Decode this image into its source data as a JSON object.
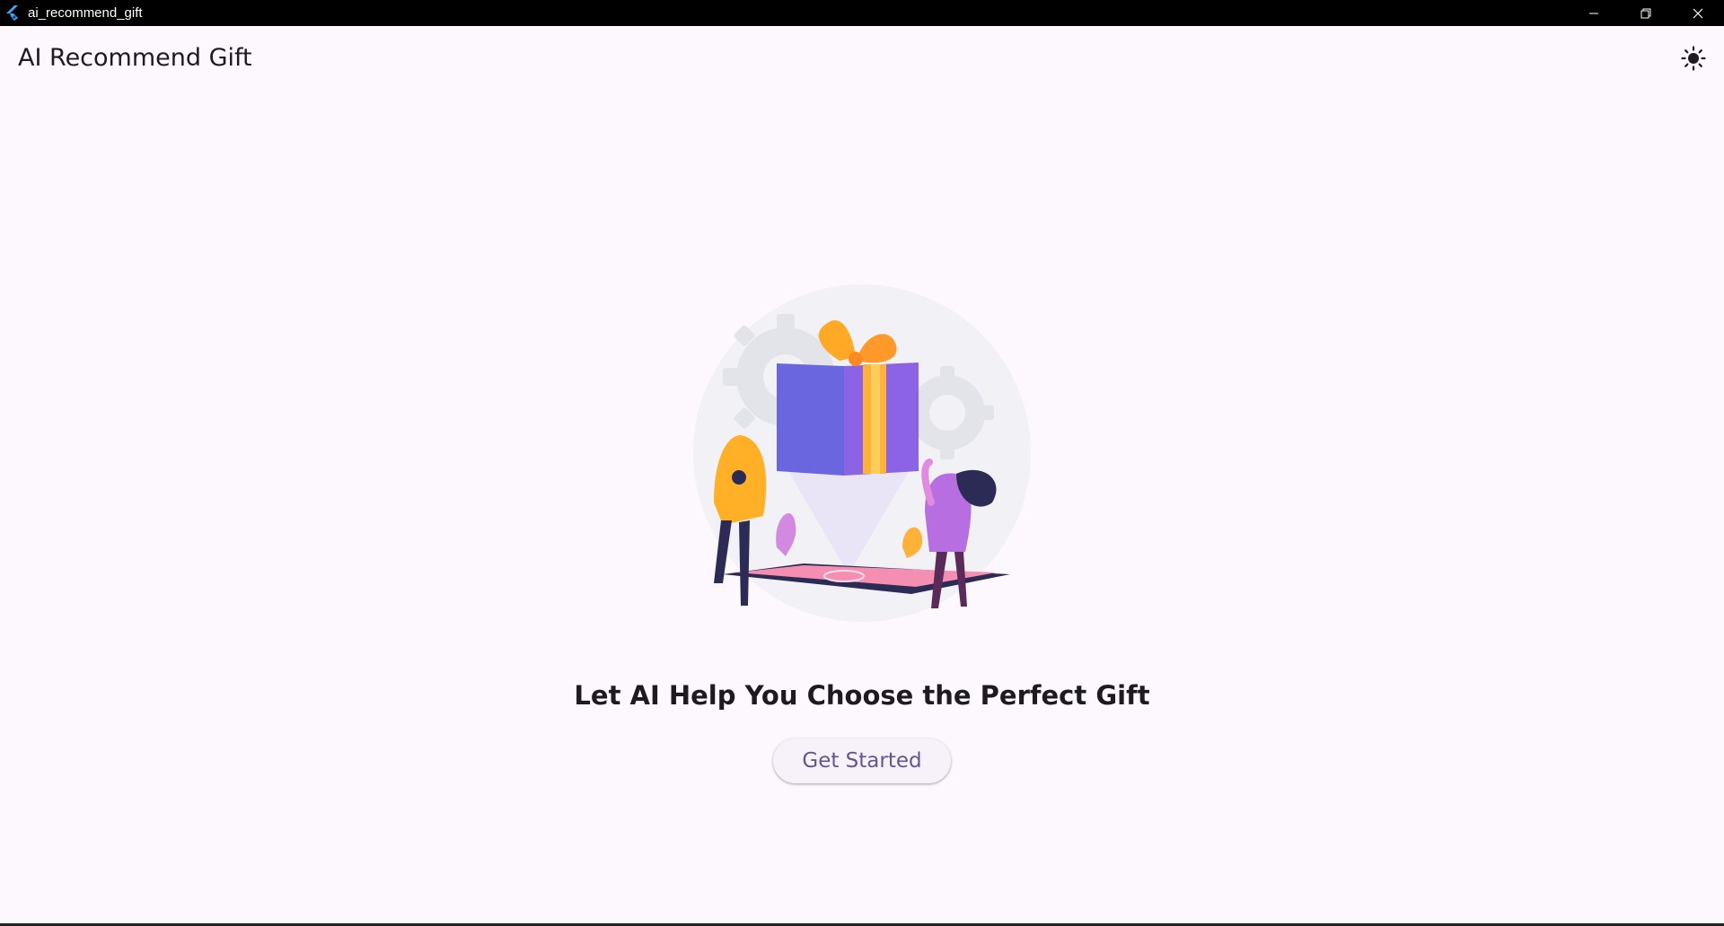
{
  "window": {
    "title": "ai_recommend_gift",
    "controls": [
      "minimize",
      "restore",
      "close"
    ]
  },
  "appbar": {
    "title": "AI Recommend Gift",
    "theme_icon": "sun-icon"
  },
  "main": {
    "illustration": "gift-illustration",
    "headline": "Let AI Help You Choose the Perfect Gift",
    "cta_label": "Get Started"
  },
  "colors": {
    "background": "#fdf7fe",
    "primary": "#65558f",
    "button_bg": "#f7f2fa"
  }
}
